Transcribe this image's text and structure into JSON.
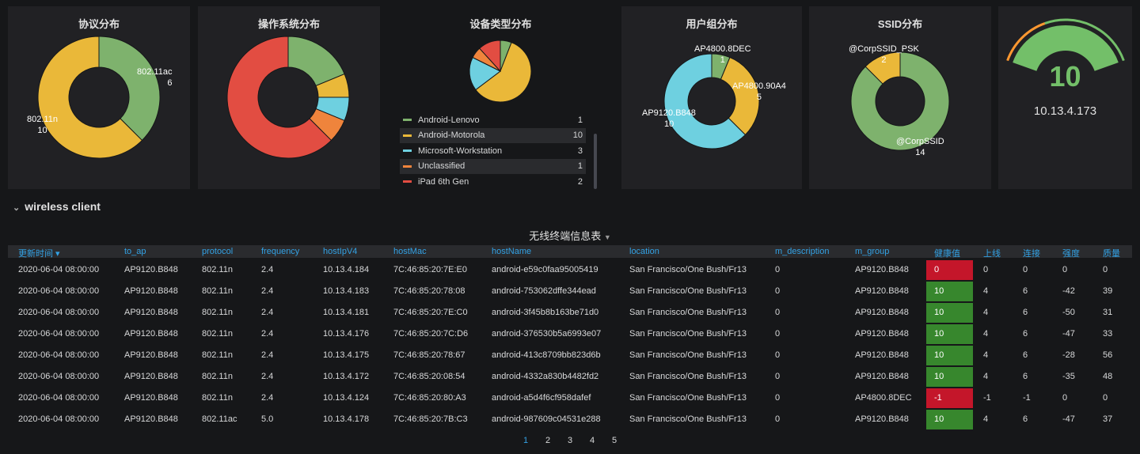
{
  "colors": {
    "green": "#7eb26d",
    "yellow": "#eab839",
    "cyan": "#6ed0e0",
    "orange": "#ef843c",
    "red": "#e24d42",
    "health_bad": "#c4162a",
    "health_good": "#37872d",
    "header_text": "#33a2e5"
  },
  "panels": {
    "protocol": {
      "title": "协议分布",
      "slices": [
        {
          "label": "802.11ac",
          "value": 6,
          "color": "#7eb26d"
        },
        {
          "label": "802.11n",
          "value": 10,
          "color": "#eab839"
        }
      ]
    },
    "os": {
      "title": "操作系统分布",
      "slices": [
        {
          "value": 3,
          "color": "#7eb26d"
        },
        {
          "value": 1,
          "color": "#eab839"
        },
        {
          "value": 1,
          "color": "#6ed0e0"
        },
        {
          "value": 1,
          "color": "#ef843c"
        },
        {
          "value": 10,
          "color": "#e24d42"
        }
      ]
    },
    "device": {
      "title": "设备类型分布",
      "slices": [
        {
          "label": "Android-Lenovo",
          "value": 1,
          "color": "#7eb26d"
        },
        {
          "label": "Android-Motorola",
          "value": 10,
          "color": "#eab839"
        },
        {
          "label": "Microsoft-Workstation",
          "value": 3,
          "color": "#6ed0e0"
        },
        {
          "label": "Unclassified",
          "value": 1,
          "color": "#ef843c"
        },
        {
          "label": "iPad 6th Gen",
          "value": 2,
          "color": "#e24d42"
        }
      ]
    },
    "usergroup": {
      "title": "用户组分布",
      "slices": [
        {
          "label": "AP4800.8DEC",
          "value": 1,
          "color": "#7eb26d"
        },
        {
          "label": "AP4800.90A4",
          "value": 5,
          "color": "#eab839"
        },
        {
          "label": "AP9120.B848",
          "value": 10,
          "color": "#6ed0e0"
        }
      ]
    },
    "ssid": {
      "title": "SSID分布",
      "slices": [
        {
          "label": "@CorpSSID",
          "value": 14,
          "color": "#7eb26d"
        },
        {
          "label": "@CorpSSID_PSK",
          "value": 2,
          "color": "#eab839"
        }
      ]
    },
    "gauge": {
      "value": "10",
      "label": "10.13.4.173",
      "fraction": 1.0,
      "color": "#73bf69",
      "threshold_color": "#ff9830"
    }
  },
  "section": {
    "title": "wireless client"
  },
  "table": {
    "title": "无线终端信息表",
    "columns": [
      "更新时间 ▾",
      "to_ap",
      "protocol",
      "frequency",
      "hostIpV4",
      "hostMac",
      "hostName",
      "location",
      "m_description",
      "m_group",
      "健康值",
      "上线",
      "连接",
      "强度",
      "质量"
    ],
    "rows": [
      [
        "2020-06-04 08:00:00",
        "AP9120.B848",
        "802.11n",
        "2.4",
        "10.13.4.184",
        "7C:46:85:20:7E:E0",
        "android-e59c0faa95005419",
        "San Francisco/One Bush/Fr13",
        "0",
        "AP9120.B848",
        "0",
        "0",
        "0",
        "0",
        "0"
      ],
      [
        "2020-06-04 08:00:00",
        "AP9120.B848",
        "802.11n",
        "2.4",
        "10.13.4.183",
        "7C:46:85:20:78:08",
        "android-753062dffe344ead",
        "San Francisco/One Bush/Fr13",
        "0",
        "AP9120.B848",
        "10",
        "4",
        "6",
        "-42",
        "39"
      ],
      [
        "2020-06-04 08:00:00",
        "AP9120.B848",
        "802.11n",
        "2.4",
        "10.13.4.181",
        "7C:46:85:20:7E:C0",
        "android-3f45b8b163be71d0",
        "San Francisco/One Bush/Fr13",
        "0",
        "AP9120.B848",
        "10",
        "4",
        "6",
        "-50",
        "31"
      ],
      [
        "2020-06-04 08:00:00",
        "AP9120.B848",
        "802.11n",
        "2.4",
        "10.13.4.176",
        "7C:46:85:20:7C:D6",
        "android-376530b5a6993e07",
        "San Francisco/One Bush/Fr13",
        "0",
        "AP9120.B848",
        "10",
        "4",
        "6",
        "-47",
        "33"
      ],
      [
        "2020-06-04 08:00:00",
        "AP9120.B848",
        "802.11n",
        "2.4",
        "10.13.4.175",
        "7C:46:85:20:78:67",
        "android-413c8709bb823d6b",
        "San Francisco/One Bush/Fr13",
        "0",
        "AP9120.B848",
        "10",
        "4",
        "6",
        "-28",
        "56"
      ],
      [
        "2020-06-04 08:00:00",
        "AP9120.B848",
        "802.11n",
        "2.4",
        "10.13.4.172",
        "7C:46:85:20:08:54",
        "android-4332a830b4482fd2",
        "San Francisco/One Bush/Fr13",
        "0",
        "AP9120.B848",
        "10",
        "4",
        "6",
        "-35",
        "48"
      ],
      [
        "2020-06-04 08:00:00",
        "AP9120.B848",
        "802.11n",
        "2.4",
        "10.13.4.124",
        "7C:46:85:20:80:A3",
        "android-a5d4f6cf958dafef",
        "San Francisco/One Bush/Fr13",
        "0",
        "AP4800.8DEC",
        "-1",
        "-1",
        "-1",
        "0",
        "0"
      ],
      [
        "2020-06-04 08:00:00",
        "AP9120.B848",
        "802.11ac",
        "5.0",
        "10.13.4.178",
        "7C:46:85:20:7B:C3",
        "android-987609c04531e288",
        "San Francisco/One Bush/Fr13",
        "0",
        "AP9120.B848",
        "10",
        "4",
        "6",
        "-47",
        "37"
      ]
    ],
    "pages": [
      "1",
      "2",
      "3",
      "4",
      "5"
    ],
    "active_page": "1"
  }
}
